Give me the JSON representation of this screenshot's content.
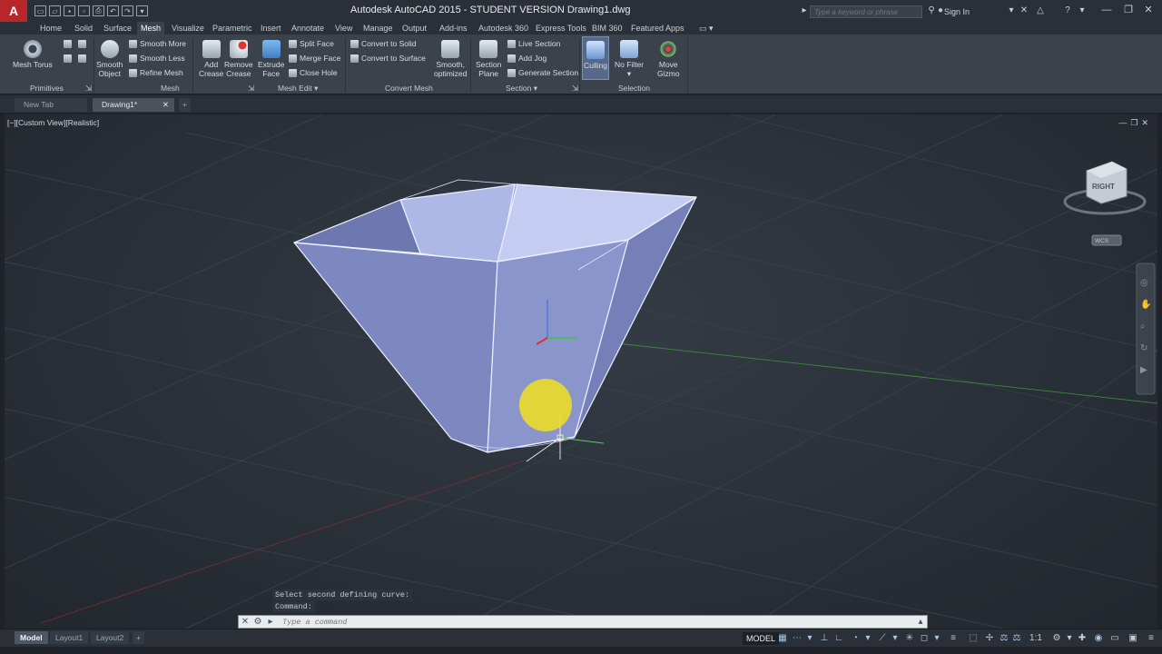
{
  "app": {
    "title": "Autodesk AutoCAD 2015 - STUDENT VERSION    Drawing1.dwg",
    "logo_letter": "A",
    "search_placeholder": "Type a keyword or phrase",
    "signin": "Sign In"
  },
  "ribbon_tabs": [
    "Home",
    "Solid",
    "Surface",
    "Mesh",
    "Visualize",
    "Parametric",
    "Insert",
    "Annotate",
    "View",
    "Manage",
    "Output",
    "Add-ins",
    "Autodesk 360",
    "Express Tools",
    "BIM 360",
    "Featured Apps"
  ],
  "active_tab": "Mesh",
  "ribbon": {
    "mesh_torus": "Mesh Torus",
    "smooth_object": [
      "Smooth",
      "Object"
    ],
    "smooth_more": "Smooth More",
    "smooth_less": "Smooth Less",
    "refine_mesh": "Refine Mesh",
    "add_crease": [
      "Add",
      "Crease"
    ],
    "remove_crease": [
      "Remove",
      "Crease"
    ],
    "extrude_face": [
      "Extrude",
      "Face"
    ],
    "split_face": "Split Face",
    "merge_face": "Merge Face",
    "close_hole": "Close Hole",
    "convert_to_solid": "Convert to Solid",
    "convert_to_surface": "Convert to Surface",
    "smooth_optimized": [
      "Smooth,",
      "optimized"
    ],
    "section_plane": [
      "Section",
      "Plane"
    ],
    "live_section": "Live Section",
    "add_jog": "Add Jog",
    "generate_section": "Generate Section",
    "culling": "Culling",
    "no_filter": "No Filter",
    "move_gizmo": [
      "Move",
      "Gizmo"
    ],
    "panels": {
      "primitives": "Primitives",
      "mesh": "Mesh",
      "mesh_edit": "Mesh Edit",
      "convert_mesh": "Convert Mesh",
      "section": "Section",
      "selection": "Selection"
    }
  },
  "file_tabs": [
    "New Tab",
    "Drawing1*"
  ],
  "viewport": {
    "label": "[−][Custom View][Realistic]",
    "viewcube_face": "RIGHT",
    "wcs": "WCS"
  },
  "command": {
    "history": [
      "Select second defining curve:",
      "Command:"
    ],
    "placeholder": "Type a command"
  },
  "status": {
    "layouts": [
      "Model",
      "Layout1",
      "Layout2"
    ],
    "model_indicator": "MODEL",
    "scale": "1:1"
  },
  "colors": {
    "accent_red": "#b8262b",
    "mesh_fill": "#8d9ad0",
    "highlight_yellow": "#f0e020"
  }
}
